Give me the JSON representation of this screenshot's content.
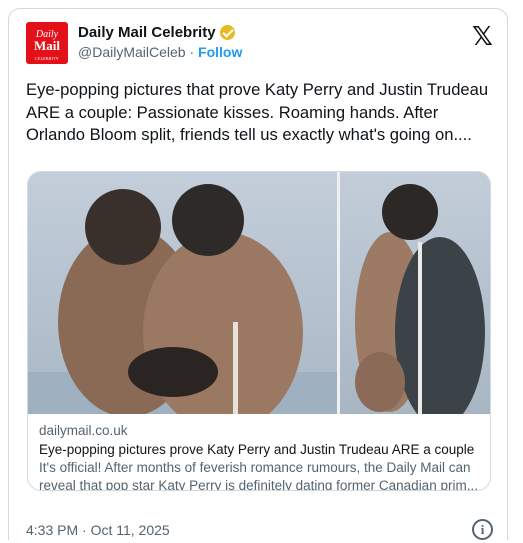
{
  "account": {
    "display_name": "Daily Mail Celebrity",
    "handle": "@DailyMailCeleb",
    "separator": "·",
    "follow_label": "Follow",
    "avatar_text": {
      "line1": "Daily",
      "line2": "Mail",
      "line3": "CELEBRITY"
    },
    "verified_color": "#e8b923"
  },
  "brand_icon": "x-logo-icon",
  "tweet": {
    "text": "Eye-popping pictures that prove Katy Perry and Justin Trudeau ARE a couple: Passionate kisses. Roaming hands. After Orlando Bloom split, friends tell us exactly what's going on...."
  },
  "link_card": {
    "domain": "dailymail.co.uk",
    "title": "Eye-popping pictures prove Katy Perry and Justin Trudeau ARE a couple",
    "description_line1": "It's official! After months of feverish romance rumours, the Daily Mail can",
    "description_line2": "reveal that pop star Katy Perry is definitely dating former Canadian prim..."
  },
  "footer": {
    "timestamp": "4:33 PM · Oct 11, 2025",
    "info_icon": "info-icon"
  },
  "colors": {
    "link": "#1d9bf0",
    "secondary_text": "#536471",
    "brand_red": "#e3101a",
    "border": "#cfd9de"
  }
}
